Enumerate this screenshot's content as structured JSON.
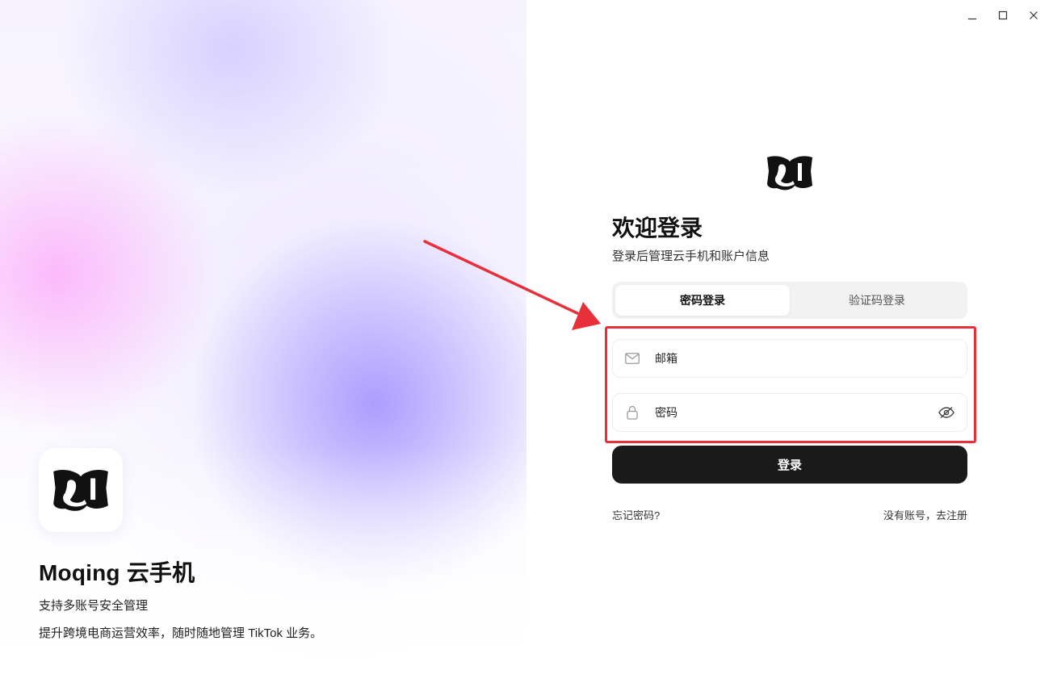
{
  "window_controls": {
    "minimize": "–",
    "maximize": "□",
    "close": "×"
  },
  "hero": {
    "title": "Moqing 云手机",
    "line1": "支持多账号安全管理",
    "line2": "提升跨境电商运营效率，随时随地管理 TikTok 业务。"
  },
  "login": {
    "title": "欢迎登录",
    "subtitle": "登录后管理云手机和账户信息",
    "tabs": [
      {
        "label": "密码登录",
        "active": true
      },
      {
        "label": "验证码登录",
        "active": false
      }
    ],
    "email": {
      "placeholder": "邮箱",
      "value": ""
    },
    "password": {
      "placeholder": "密码",
      "value": ""
    },
    "submit_label": "登录",
    "forgot_label": "忘记密码?",
    "register_label": "没有账号，去注册"
  },
  "annotation": {
    "color": "#e8303a"
  },
  "colors": {
    "accent": "#1a1a1a",
    "highlight": "#e8303a"
  },
  "icons": [
    "minimize-icon",
    "maximize-icon",
    "close-icon",
    "logo-icon",
    "mail-icon",
    "lock-icon",
    "eye-off-icon"
  ]
}
